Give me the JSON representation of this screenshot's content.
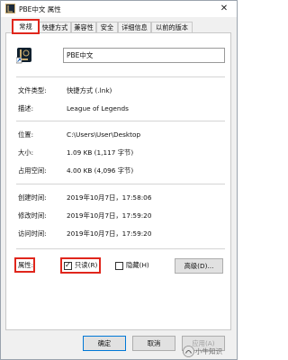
{
  "window": {
    "title": "PBE中文 属性",
    "close_glyph": "✕"
  },
  "tabs": [
    {
      "label": "常规",
      "active": true
    },
    {
      "label": "快捷方式",
      "active": false
    },
    {
      "label": "兼容性",
      "active": false
    },
    {
      "label": "安全",
      "active": false
    },
    {
      "label": "详细信息",
      "active": false
    },
    {
      "label": "以前的版本",
      "active": false
    }
  ],
  "general": {
    "name_value": "PBE中文",
    "fields": [
      {
        "label": "文件类型:",
        "value": "快捷方式 (.lnk)"
      },
      {
        "label": "描述:",
        "value": "League of Legends"
      },
      {
        "label": "位置:",
        "value": "C:\\Users\\User\\Desktop"
      },
      {
        "label": "大小:",
        "value": "1.09 KB (1,117 字节)"
      },
      {
        "label": "占用空间:",
        "value": "4.00 KB (4,096 字节)"
      },
      {
        "label": "创建时间:",
        "value": "2019年10月7日，17:58:06"
      },
      {
        "label": "修改时间:",
        "value": "2019年10月7日，17:59:20"
      },
      {
        "label": "访问时间:",
        "value": "2019年10月7日，17:59:20"
      }
    ],
    "attributes": {
      "label": "属性:",
      "readonly_label": "只读(R)",
      "readonly_checked": true,
      "hidden_label": "隐藏(H)",
      "hidden_checked": false,
      "advanced_label": "高级(D)..."
    }
  },
  "buttons": {
    "ok": "确定",
    "cancel": "取消",
    "apply": "应用(A)"
  },
  "colors": {
    "highlight": "#e0261c",
    "focus": "#0078d7"
  }
}
